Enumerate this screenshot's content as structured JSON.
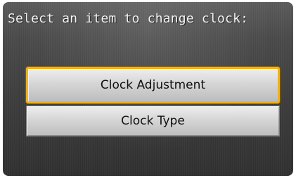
{
  "prompt": "Select an item to change clock:",
  "menu": {
    "items": [
      {
        "label": "Clock Adjustment",
        "selected": true
      },
      {
        "label": "Clock Type",
        "selected": false
      }
    ]
  },
  "colors": {
    "highlight": "#f0b21a",
    "background": "#4a4a4a",
    "button": "#d6d6d6"
  }
}
